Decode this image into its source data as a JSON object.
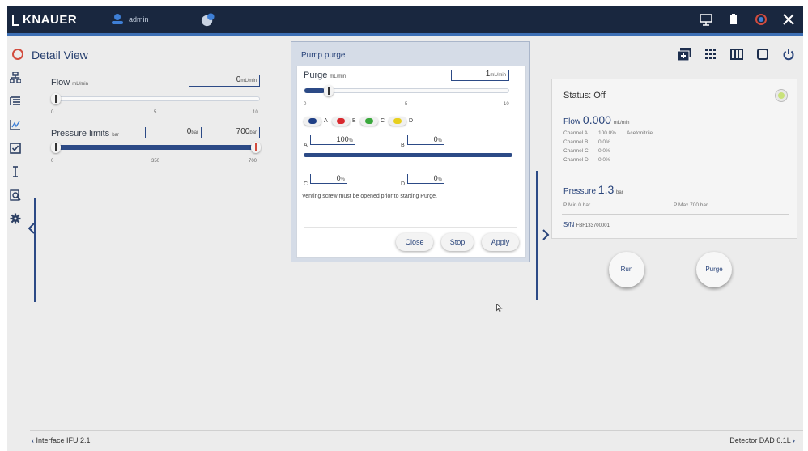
{
  "topbar": {
    "brand": "KNAUER",
    "user": "admin",
    "icons": [
      "user-icon",
      "globe-icon",
      "remote-display-icon",
      "battery-icon",
      "power-ring-icon",
      "close-icon"
    ]
  },
  "view": {
    "title": "Detail View",
    "tools": [
      "add-panel-icon",
      "grid-icon",
      "columns-icon",
      "square-icon",
      "power-icon"
    ]
  },
  "sidebar": {
    "icons": [
      "network-icon",
      "list-icon",
      "chart-icon",
      "checkbox-icon",
      "cursor-icon",
      "search-doc-icon",
      "gear-icon"
    ]
  },
  "flow": {
    "label": "Flow",
    "unit": "mL/min",
    "value": "0",
    "value_unit": "mL/min",
    "ticks": [
      "0",
      "5",
      "10"
    ],
    "level": 0.0
  },
  "pressure_limits": {
    "label": "Pressure limits",
    "unit": "bar",
    "min_value": "0",
    "min_unit": "bar",
    "max_value": "700",
    "max_unit": "bar",
    "ticks": [
      "0",
      "350",
      "700"
    ]
  },
  "dialog": {
    "title": "Pump purge",
    "purge_label": "Purge",
    "purge_unit": "mL/min",
    "purge_value": "1",
    "purge_value_unit": "mL/min",
    "ticks": [
      "0",
      "5",
      "10"
    ],
    "level": 0.1,
    "channels": [
      {
        "name": "A",
        "color": "#1f3f86"
      },
      {
        "name": "B",
        "color": "#d8282e"
      },
      {
        "name": "C",
        "color": "#3aa83c"
      },
      {
        "name": "D",
        "color": "#e7cf1e"
      }
    ],
    "comp_a_label": "A",
    "comp_a_value": "100",
    "comp_b_label": "B",
    "comp_b_value": "0",
    "comp_c_label": "C",
    "comp_c_value": "0",
    "comp_d_label": "D",
    "comp_d_value": "0",
    "percent": "%",
    "note": "Venting screw must be opened prior to starting Purge.",
    "buttons": {
      "close": "Close",
      "stop": "Stop",
      "apply": "Apply"
    }
  },
  "status": {
    "title": "Status: Off",
    "flow_label": "Flow",
    "flow_value": "0.000",
    "flow_unit": "mL/min",
    "channel_a": "Channel A",
    "channel_a_value": "100.0%",
    "channel_a_solvent": "Acetonitrile",
    "channel_b": "Channel B",
    "channel_b_value": "0.0%",
    "channel_c": "Channel C",
    "channel_c_value": "0.0%",
    "channel_d": "Channel D",
    "channel_d_value": "0.0%",
    "pressure_label": "Pressure",
    "pressure_value": "1.3",
    "pressure_unit": "bar",
    "pmin": "P Min  0 bar",
    "pmax": "P Max  700 bar",
    "sn_label": "S/N",
    "sn_value": "FBF133700001",
    "led_color": "#c9e27a"
  },
  "actions": {
    "run": "Run",
    "purge": "Purge"
  },
  "footer": {
    "left": "Interface IFU 2.1",
    "right": "Detector DAD 6.1L"
  }
}
